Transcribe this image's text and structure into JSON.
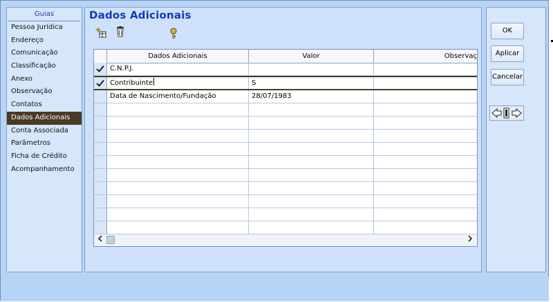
{
  "tabs": {
    "header": "Guias",
    "items": [
      {
        "label": "Pessoa Jurídica"
      },
      {
        "label": "Endereço"
      },
      {
        "label": "Comunicação"
      },
      {
        "label": "Classificação"
      },
      {
        "label": "Anexo"
      },
      {
        "label": "Observação"
      },
      {
        "label": "Contatos"
      },
      {
        "label": "Dados Adicionais",
        "active": true
      },
      {
        "label": "Conta Associada"
      },
      {
        "label": "Parâmetros"
      },
      {
        "label": "Ficha de Crédito"
      },
      {
        "label": "Acompanhamento"
      }
    ]
  },
  "main": {
    "title": "Dados Adicionais",
    "toolbar": {
      "icons": [
        "add-record-icon",
        "trash-icon",
        "help-key-icon"
      ]
    },
    "grid": {
      "columns": [
        "Dados Adicionais",
        "Valor",
        "Observaç"
      ],
      "rows": [
        {
          "checked": true,
          "dado": "C.N.P.J.",
          "valor": "",
          "obs": ""
        },
        {
          "checked": true,
          "dado": "Contribuinte",
          "valor": "S",
          "obs": "",
          "editing": true
        },
        {
          "checked": false,
          "dado": "Data de Nascimento/Fundação",
          "valor": "28/07/1983",
          "obs": ""
        }
      ],
      "empty_rows": 10
    }
  },
  "buttons": {
    "ok": "OK",
    "apply": "Aplicar",
    "cancel": "Cancelar"
  }
}
